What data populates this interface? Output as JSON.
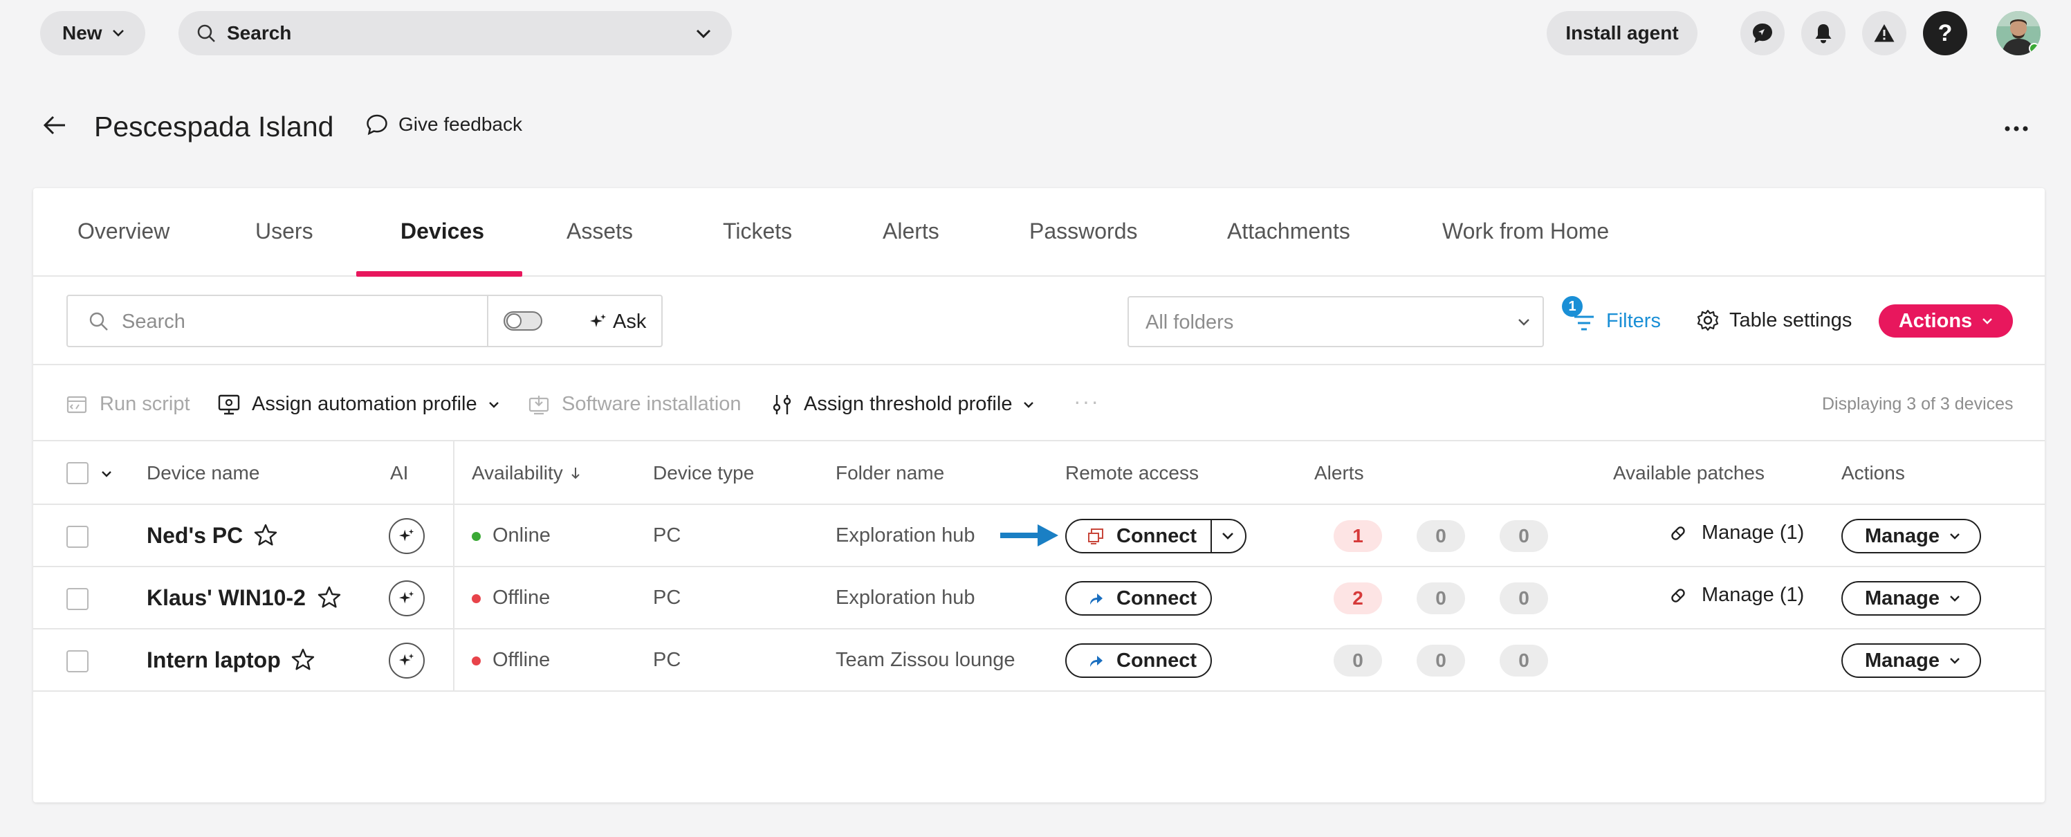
{
  "topbar": {
    "new_label": "New",
    "search_label": "Search",
    "install_agent_label": "Install agent"
  },
  "page": {
    "title": "Pescespada Island",
    "feedback_label": "Give feedback"
  },
  "tabs": [
    {
      "label": "Overview"
    },
    {
      "label": "Users"
    },
    {
      "label": "Devices"
    },
    {
      "label": "Assets"
    },
    {
      "label": "Tickets"
    },
    {
      "label": "Alerts"
    },
    {
      "label": "Passwords"
    },
    {
      "label": "Attachments"
    },
    {
      "label": "Work from Home"
    }
  ],
  "toolbar": {
    "search_placeholder": "Search",
    "ask_label": "Ask",
    "folders_placeholder": "All folders",
    "filters_label": "Filters",
    "filters_count": "1",
    "table_settings_label": "Table settings",
    "actions_label": "Actions"
  },
  "bulk_actions": {
    "run_script": "Run script",
    "assign_automation": "Assign automation profile",
    "software_install": "Software installation",
    "assign_threshold": "Assign threshold profile",
    "more": "···",
    "displaying": "Displaying 3 of 3 devices"
  },
  "table": {
    "columns": {
      "device_name": "Device name",
      "ai": "AI",
      "availability": "Availability",
      "device_type": "Device type",
      "folder_name": "Folder name",
      "remote_access": "Remote access",
      "alerts": "Alerts",
      "patches": "Available patches",
      "actions": "Actions"
    },
    "rows": [
      {
        "name": "Ned's PC",
        "status": "Online",
        "status_color": "#3aa935",
        "type": "PC",
        "folder": "Exploration hub",
        "connect": "Connect",
        "alerts": [
          "1",
          "0",
          "0"
        ],
        "patches": "Manage (1)",
        "manage": "Manage"
      },
      {
        "name": "Klaus' WIN10-2",
        "status": "Offline",
        "status_color": "#e8434a",
        "type": "PC",
        "folder": "Exploration hub",
        "connect": "Connect",
        "alerts": [
          "2",
          "0",
          "0"
        ],
        "patches": "Manage (1)",
        "manage": "Manage"
      },
      {
        "name": "Intern laptop",
        "status": "Offline",
        "status_color": "#e8434a",
        "type": "PC",
        "folder": "Team Zissou lounge",
        "connect": "Connect",
        "alerts": [
          "0",
          "0",
          "0"
        ],
        "patches": "",
        "manage": "Manage"
      }
    ]
  },
  "colors": {
    "accent": "#e8175d",
    "link": "#1a8fd6",
    "arrow": "#1a7fc4"
  }
}
